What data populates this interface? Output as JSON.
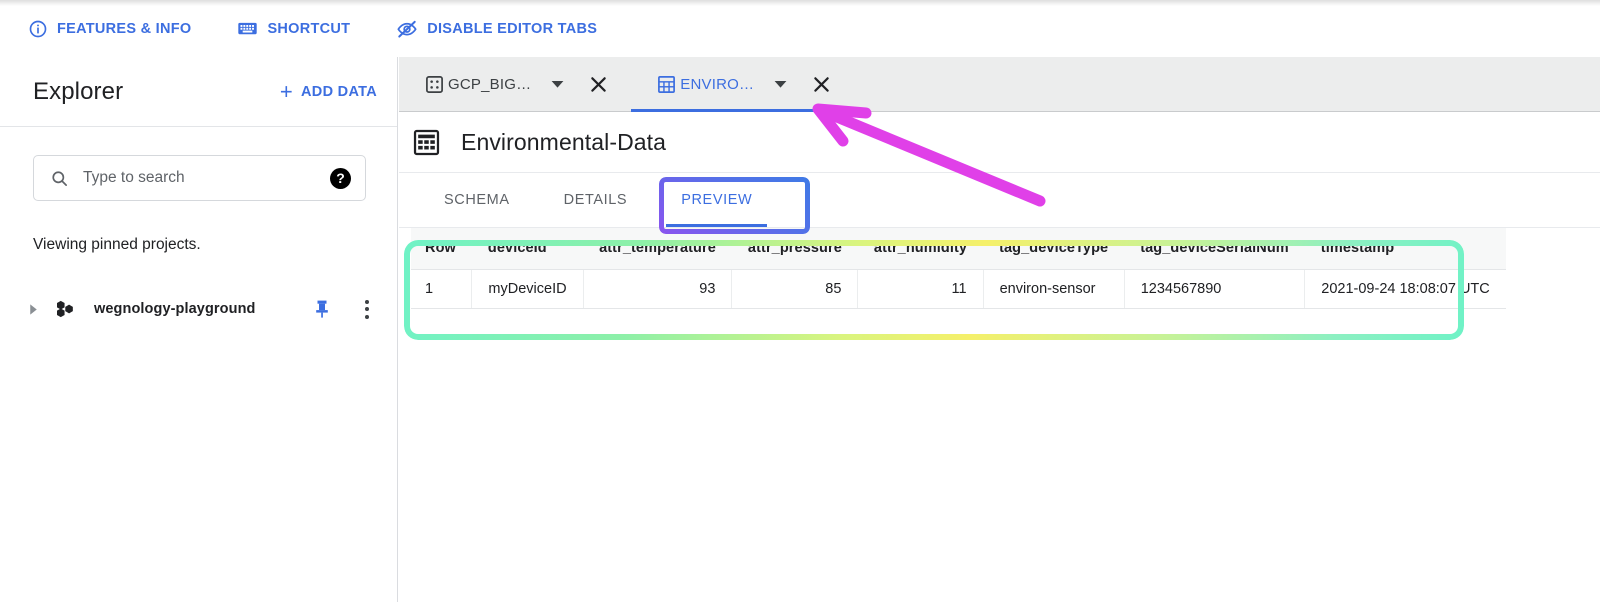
{
  "header": {
    "actions": [
      {
        "label": "FEATURES & INFO",
        "icon": "info-circle-icon"
      },
      {
        "label": "SHORTCUT",
        "icon": "keyboard-icon"
      },
      {
        "label": "DISABLE EDITOR TABS",
        "icon": "eye-slash-icon"
      }
    ]
  },
  "sidebar": {
    "title": "Explorer",
    "add_data_label": "ADD DATA",
    "search": {
      "placeholder": "Type to search",
      "value": "",
      "help_label": "?"
    },
    "note": "Viewing pinned projects.",
    "project": {
      "name": "wegnology-playground"
    }
  },
  "editor": {
    "tabs": [
      {
        "label": "GCP_BIG…",
        "icon": "dataset-icon",
        "active": false
      },
      {
        "label": "ENVIRO…",
        "icon": "table-icon",
        "active": true
      }
    ],
    "dataset": {
      "title": "Environmental-Data",
      "icon": "table-icon"
    },
    "subtabs": [
      {
        "label": "SCHEMA",
        "active": false
      },
      {
        "label": "DETAILS",
        "active": false
      },
      {
        "label": "PREVIEW",
        "active": true
      }
    ]
  },
  "preview_table": {
    "columns": [
      {
        "label": "Row",
        "align": "left"
      },
      {
        "label": "deviceId",
        "align": "left"
      },
      {
        "label": "attr_temperature",
        "align": "right"
      },
      {
        "label": "attr_pressure",
        "align": "right"
      },
      {
        "label": "attr_humidity",
        "align": "right"
      },
      {
        "label": "tag_deviceType",
        "align": "left"
      },
      {
        "label": "tag_deviceSerialNum",
        "align": "left"
      },
      {
        "label": "timestamp",
        "align": "left"
      }
    ],
    "rows": [
      {
        "Row": "1",
        "deviceId": "myDeviceID",
        "attr_temperature": "93",
        "attr_pressure": "85",
        "attr_humidity": "11",
        "tag_deviceType": "environ-sensor",
        "tag_deviceSerialNum": "1234567890",
        "timestamp": "2021-09-24 18:08:07 UTC"
      }
    ]
  },
  "annotations": {
    "table_highlight_color": "#6ff2c6",
    "preview_box_color": "#8a54ef",
    "arrow_color": "#e040e8"
  },
  "colors": {
    "accent_blue": "#3c6ee0",
    "text_primary": "#202124",
    "text_secondary": "#5f6368",
    "tabstrip_bg": "#eceded"
  }
}
